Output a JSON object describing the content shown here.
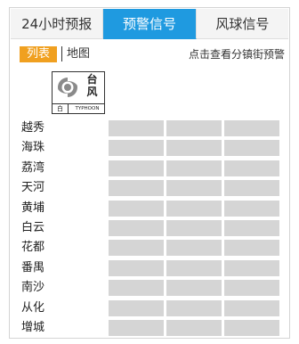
{
  "tabs": [
    {
      "label": "24小时预报",
      "active": false
    },
    {
      "label": "预警信号",
      "active": true
    },
    {
      "label": "风球信号",
      "active": false
    }
  ],
  "view_switch": {
    "list_label": "列表",
    "map_label": "地图",
    "hint": "点击查看分镇街预警"
  },
  "signal": {
    "icon": "typhoon-icon",
    "category": [
      "台",
      "风"
    ],
    "level": "白",
    "english": "TYPHOON",
    "color": "#888888"
  },
  "districts": [
    "越秀",
    "海珠",
    "荔湾",
    "天河",
    "黄埔",
    "白云",
    "花都",
    "番禺",
    "南沙",
    "从化",
    "增城"
  ],
  "colors": {
    "accent": "#1f9ae0",
    "list_active": "#f0a020",
    "cell_empty": "#d5d5d5"
  }
}
